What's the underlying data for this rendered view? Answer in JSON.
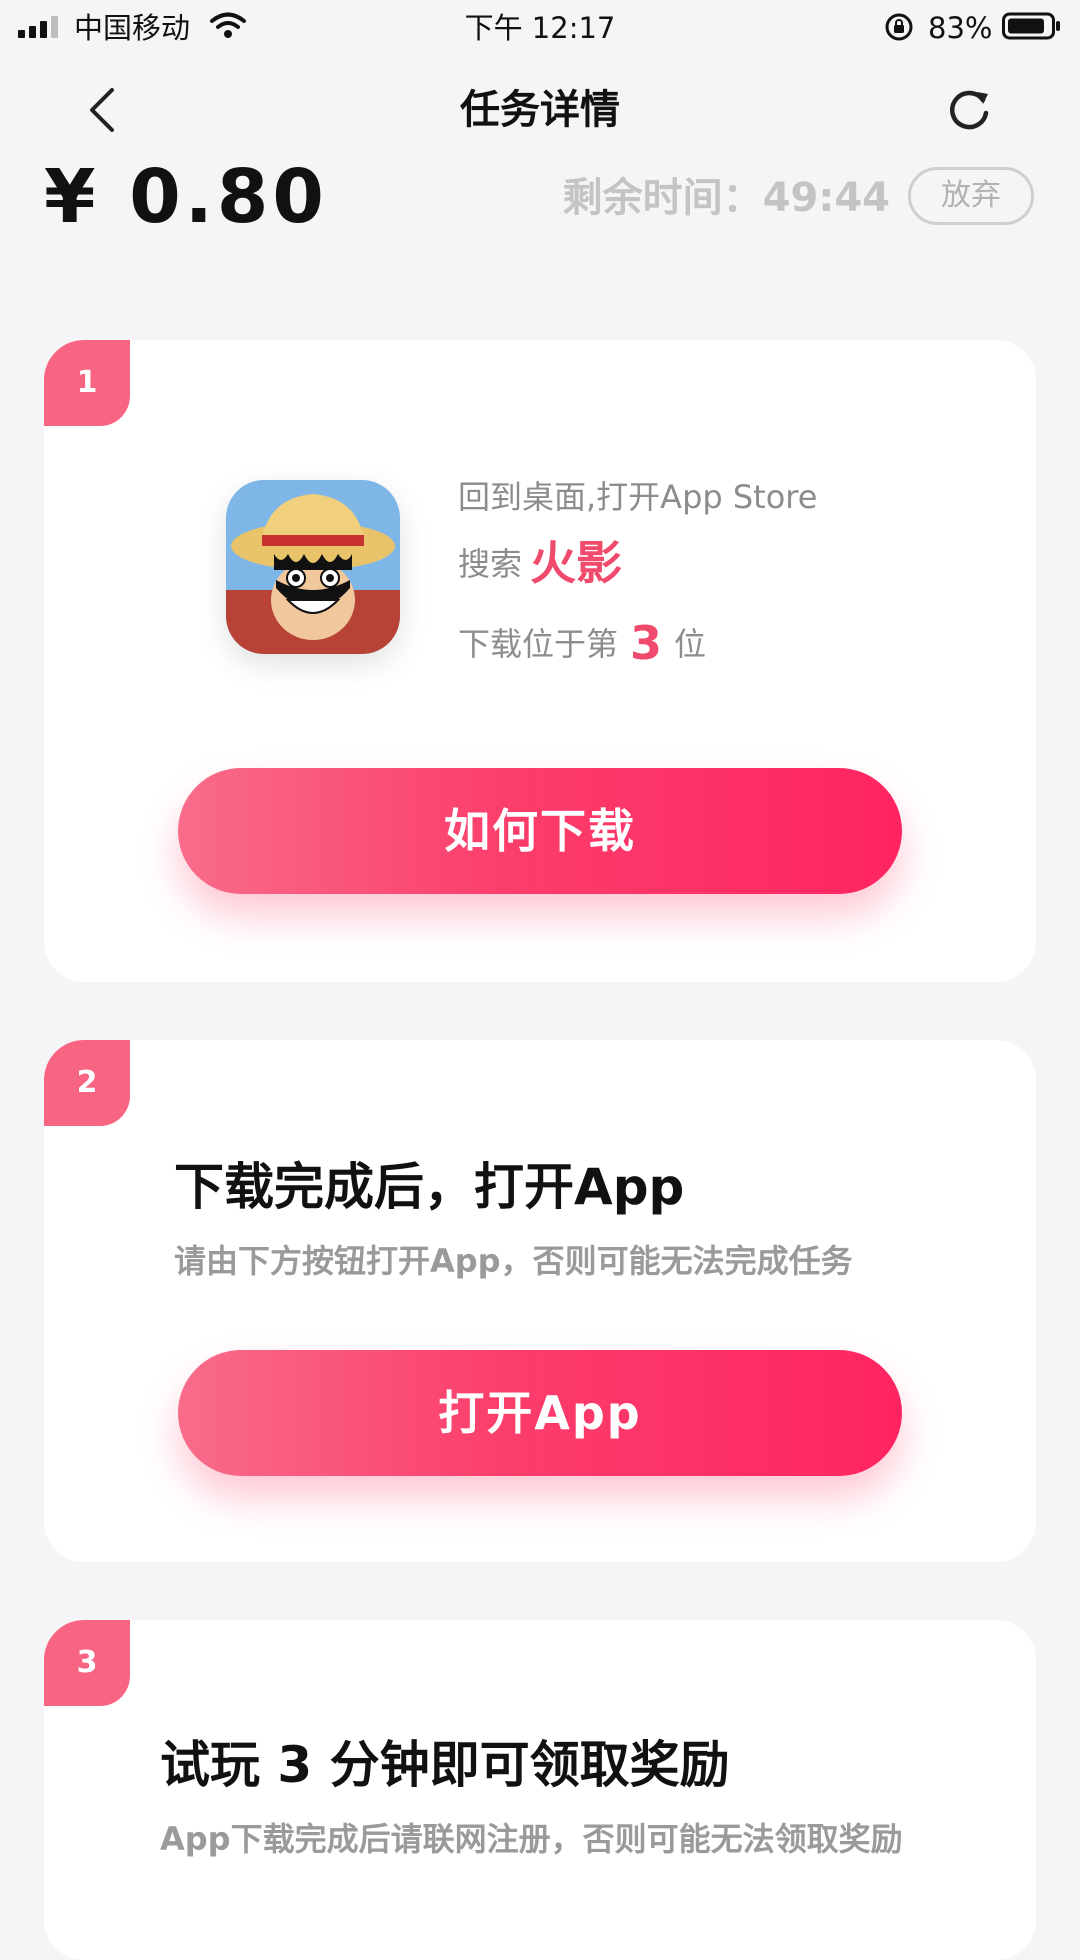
{
  "status_bar": {
    "carrier": "中国移动",
    "time": "下午 12:17",
    "battery_percent": "83%",
    "battery_level": 0.83,
    "icons": [
      "signal-icon",
      "wifi-icon",
      "orientation-lock-icon",
      "battery-icon"
    ]
  },
  "nav": {
    "title": "任务详情",
    "icons": [
      "back-icon",
      "refresh-icon"
    ]
  },
  "reward": {
    "amount": "¥ 0.80",
    "remaining_time": "剩余时间：49:44",
    "abandon_label": "放弃"
  },
  "steps": [
    {
      "badge": "1",
      "instruction_line1": "回到桌面,打开App Store",
      "search_prefix": "搜索",
      "search_keyword": "火影",
      "rank_prefix": "下载位于第",
      "rank_number": "3",
      "rank_suffix": "位",
      "button_label": "如何下载"
    },
    {
      "badge": "2",
      "heading": "下载完成后，打开App",
      "subtext": "请由下方按钮打开App，否则可能无法完成任务",
      "button_label": "打开App"
    },
    {
      "badge": "3",
      "heading": "试玩 3 分钟即可领取奖励",
      "subtext": "App下载完成后请联网注册，否则可能无法领取奖励"
    }
  ],
  "colors": {
    "accent": "#fb3e6b",
    "badge": "#f76583",
    "keyword": "#f04a6c",
    "background": "#f5f5f7"
  }
}
